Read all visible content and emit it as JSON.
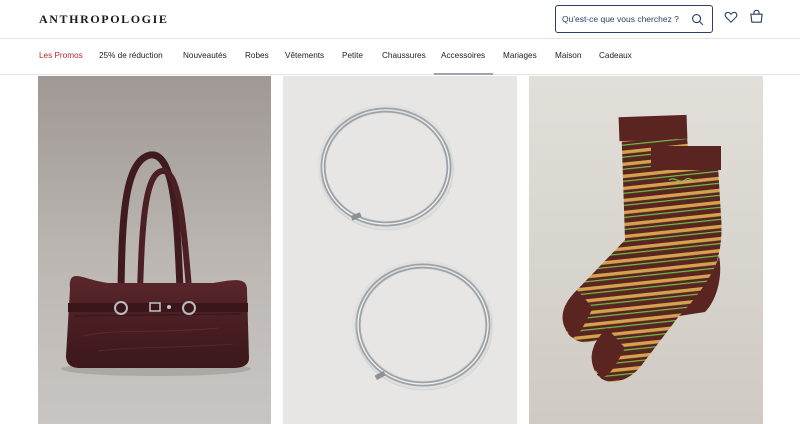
{
  "header": {
    "logo": "ANTHROPOLOGIE",
    "search": {
      "placeholder": "Qu'est-ce que vous cherchez ?",
      "value": ""
    },
    "icons": [
      "search-icon",
      "heart-icon",
      "shopping-bag-icon"
    ]
  },
  "nav": {
    "items": [
      {
        "label": "Les Promos"
      },
      {
        "label": "25% de réduction"
      },
      {
        "label": "Nouveautés"
      },
      {
        "label": "Robes"
      },
      {
        "label": "Vêtements"
      },
      {
        "label": "Petite"
      },
      {
        "label": "Chaussures"
      },
      {
        "label": "Accessoires"
      },
      {
        "label": "Mariages"
      },
      {
        "label": "Maison"
      },
      {
        "label": "Cadeaux"
      }
    ],
    "active": "Accessoires"
  },
  "products": [
    {
      "kind": "shoulder-bag",
      "colors": {
        "bg": "#bcb7b3",
        "main": "#4a1f23"
      }
    },
    {
      "kind": "hoop-earrings",
      "colors": {
        "bg": "#e6e5e3",
        "main": "#a9acb0"
      }
    },
    {
      "kind": "striped-socks",
      "colors": {
        "bg": "#d8d4cd",
        "main": "#5a2420",
        "stripe": "#d8a84f",
        "accent": "#6fbf4a"
      }
    }
  ],
  "theme": {
    "promo": "#b22a2a",
    "search_border": "#2a3f6a",
    "nav_underline": "#9aa6b6"
  }
}
